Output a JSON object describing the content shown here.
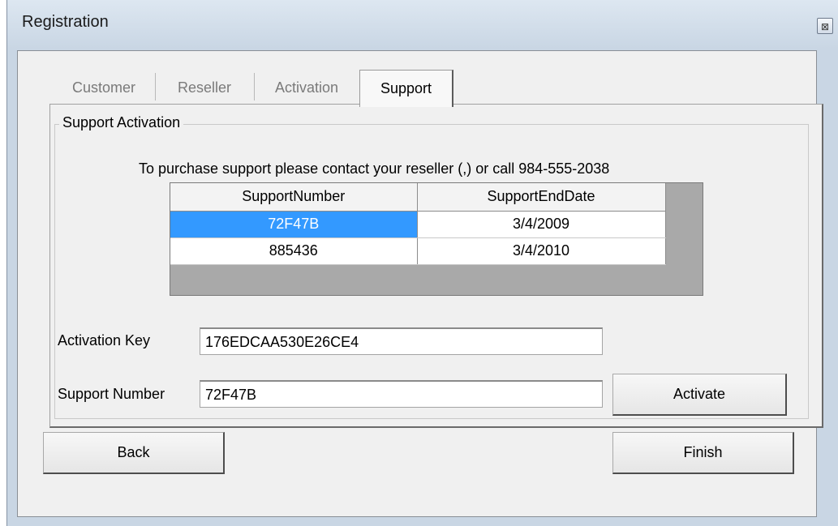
{
  "window": {
    "title": "Registration",
    "close_glyph": "⊠"
  },
  "tabs": [
    {
      "label": "Customer",
      "active": false
    },
    {
      "label": "Reseller",
      "active": false
    },
    {
      "label": "Activation",
      "active": false
    },
    {
      "label": "Support",
      "active": true
    }
  ],
  "support": {
    "group_title": "Support Activation",
    "info_text": "To purchase support please contact your reseller (,) or call 984-555-2038",
    "grid": {
      "columns": [
        "SupportNumber",
        "SupportEndDate"
      ],
      "rows": [
        {
          "number": "72F47B",
          "end_date": "3/4/2009",
          "selected": true
        },
        {
          "number": "885436",
          "end_date": "3/4/2010",
          "selected": false
        }
      ]
    },
    "activation_key_label": "Activation Key",
    "activation_key_value": "176EDCAA530E26CE4",
    "support_number_label": "Support Number",
    "support_number_value": "72F47B",
    "activate_button": "Activate"
  },
  "footer": {
    "back_button": "Back",
    "finish_button": "Finish"
  },
  "colors": {
    "selection": "#3399ff",
    "grid_background": "#a9a9a9"
  }
}
